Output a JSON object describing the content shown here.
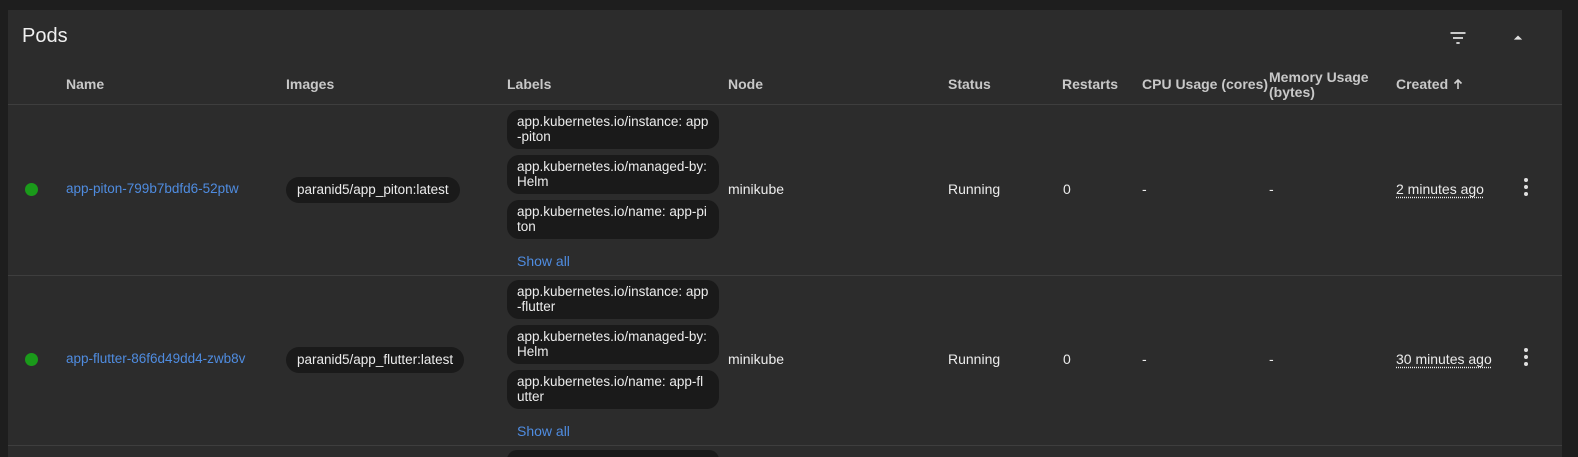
{
  "panel": {
    "title": "Pods",
    "filter_icon": "filter-icon",
    "collapse_icon": "chevron-up-icon"
  },
  "columns": {
    "name": "Name",
    "images": "Images",
    "labels": "Labels",
    "node": "Node",
    "status": "Status",
    "restarts": "Restarts",
    "cpu": "CPU Usage (cores)",
    "memory_line1": "Memory Usage",
    "memory_line2": "(bytes)",
    "created": "Created",
    "created_sort_icon": "arrow-up-icon"
  },
  "rows": [
    {
      "status_color": "#1a9a1a",
      "name": "app-piton-799b7bdfd6-52ptw",
      "image": "paranid5/app_piton:latest",
      "labels": [
        "app.kubernetes.io/instance: app-piton",
        "app.kubernetes.io/managed-by: Helm",
        "app.kubernetes.io/name: app-piton"
      ],
      "show_all": "Show all",
      "node": "minikube",
      "status": "Running",
      "restarts": "0",
      "cpu": "-",
      "memory": "-",
      "created": "2 minutes ago"
    },
    {
      "status_color": "#1a9a1a",
      "name": "app-flutter-86f6d49dd4-zwb8v",
      "image": "paranid5/app_flutter:latest",
      "labels": [
        "app.kubernetes.io/instance: app-flutter",
        "app.kubernetes.io/managed-by: Helm",
        "app.kubernetes.io/name: app-flutter"
      ],
      "show_all": "Show all",
      "node": "minikube",
      "status": "Running",
      "restarts": "0",
      "cpu": "-",
      "memory": "-",
      "created": "30 minutes ago"
    }
  ]
}
